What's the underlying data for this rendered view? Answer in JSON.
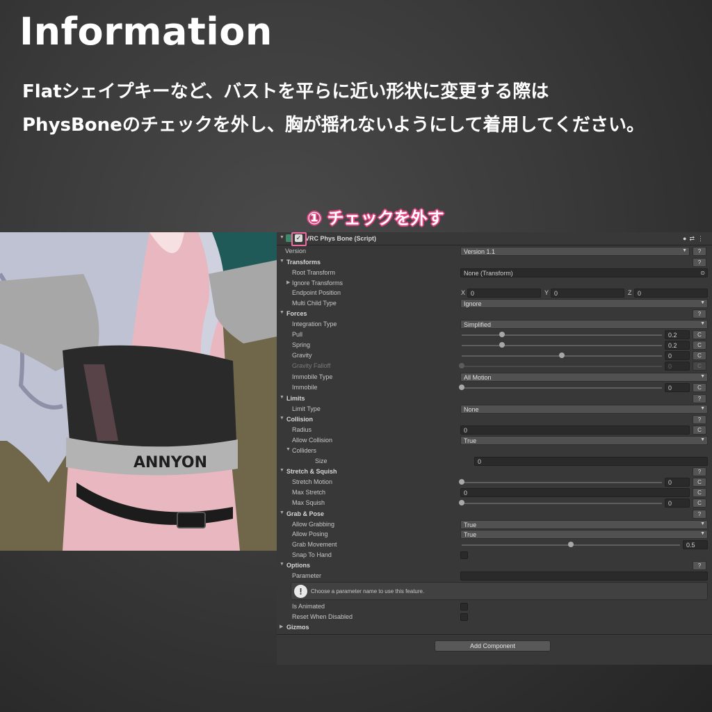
{
  "header": {
    "title": "Information",
    "line1": "Flatシェイプキーなど、バストを平らに近い形状に変更する際は",
    "line2": "PhysBoneのチェックを外し、胸が揺れないようにして着用してください。"
  },
  "callout": {
    "label": "① チェックを外す"
  },
  "illustration": {
    "logo_text": "ANNYON"
  },
  "component": {
    "name": "VRC Phys Bone (Script)",
    "icons": {
      "help": "help-icon",
      "presets": "presets-icon",
      "menu": "kebab-menu-icon"
    }
  },
  "fields": {
    "version": {
      "label": "Version",
      "value": "Version 1.1"
    },
    "transforms": "Transforms",
    "root_transform": {
      "label": "Root Transform",
      "value": "None (Transform)"
    },
    "ignore_transforms": "Ignore Transforms",
    "endpoint_position": {
      "label": "Endpoint Position",
      "x_label": "X",
      "x": "0",
      "y_label": "Y",
      "y": "0",
      "z_label": "Z",
      "z": "0"
    },
    "multi_child_type": {
      "label": "Multi Child Type",
      "value": "Ignore"
    },
    "forces": "Forces",
    "integration_type": {
      "label": "Integration Type",
      "value": "Simplified"
    },
    "pull": {
      "label": "Pull",
      "value": "0.2",
      "fraction": 0.2
    },
    "spring": {
      "label": "Spring",
      "value": "0.2",
      "fraction": 0.2
    },
    "gravity": {
      "label": "Gravity",
      "value": "0",
      "fraction": 0.5
    },
    "gravity_falloff": {
      "label": "Gravity Falloff",
      "value": "0",
      "fraction": 0
    },
    "immobile_type": {
      "label": "Immobile Type",
      "value": "All Motion"
    },
    "immobile": {
      "label": "Immobile",
      "value": "0",
      "fraction": 0
    },
    "limits": "Limits",
    "limit_type": {
      "label": "Limit Type",
      "value": "None"
    },
    "collision": "Collision",
    "radius": {
      "label": "Radius",
      "value": "0"
    },
    "allow_collision": {
      "label": "Allow Collision",
      "value": "True"
    },
    "colliders": "Colliders",
    "size": {
      "label": "Size",
      "value": "0"
    },
    "stretch_squish": "Stretch & Squish",
    "stretch_motion": {
      "label": "Stretch Motion",
      "value": "0",
      "fraction": 0
    },
    "max_stretch": {
      "label": "Max Stretch",
      "value": "0"
    },
    "max_squish": {
      "label": "Max Squish",
      "value": "0",
      "fraction": 0
    },
    "grab_pose": "Grab & Pose",
    "allow_grabbing": {
      "label": "Allow Grabbing",
      "value": "True"
    },
    "allow_posing": {
      "label": "Allow Posing",
      "value": "True"
    },
    "grab_movement": {
      "label": "Grab Movement",
      "value": "0.5",
      "fraction": 0.5
    },
    "snap_to_hand": {
      "label": "Snap To Hand"
    },
    "options": "Options",
    "parameter": {
      "label": "Parameter",
      "value": ""
    },
    "help_text": "Choose a parameter name to use this feature.",
    "is_animated": {
      "label": "Is Animated"
    },
    "reset_when_disabled": {
      "label": "Reset When Disabled"
    },
    "gizmos": "Gizmos"
  },
  "buttons": {
    "help": "?",
    "curve": "C",
    "add_component": "Add Component"
  }
}
